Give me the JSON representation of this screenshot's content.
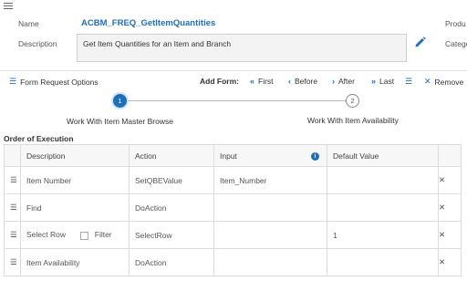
{
  "header": {
    "name_label": "Name",
    "name_value": "ACBM_FREQ_GetItemQuantities",
    "description_label": "Description",
    "description_value": "Get Item Quantities for an Item and Branch",
    "right_labels": [
      "Produ",
      "Catego"
    ]
  },
  "toolbar": {
    "form_request_options": "Form Request Options",
    "add_form_label": "Add Form:",
    "first": "First",
    "before": "Before",
    "after": "After",
    "last": "Last",
    "remove": "Remove"
  },
  "stepper": {
    "steps": [
      {
        "number": "1",
        "label": "Work With Item Master Browse",
        "active": true
      },
      {
        "number": "2",
        "label": "Work With Item Availability",
        "active": false
      }
    ]
  },
  "order": {
    "title": "Order of Execution",
    "columns": [
      "Description",
      "Action",
      "Input",
      "Default Value"
    ],
    "rows": [
      {
        "description": "Item Number",
        "action": "SetQBEValue",
        "input": "Item_Number",
        "default": ""
      },
      {
        "description": "Find",
        "action": "DoAction",
        "input": "",
        "default": ""
      },
      {
        "description": "Select Row",
        "filter_label": "Filter",
        "action": "SelectRow",
        "input": "",
        "default": "1"
      },
      {
        "description": "Item Availability",
        "action": "DoAction",
        "input": "",
        "default": ""
      }
    ]
  },
  "icons": {
    "menu": "hamburger-menu-icon",
    "edit": "pencil-icon",
    "list": "list-icon",
    "info": "info-icon",
    "delete": "close-x-icon",
    "drag": "drag-handle-icon"
  },
  "colors": {
    "accent": "#1f6fb8",
    "step_active": "#1f6fb8"
  }
}
